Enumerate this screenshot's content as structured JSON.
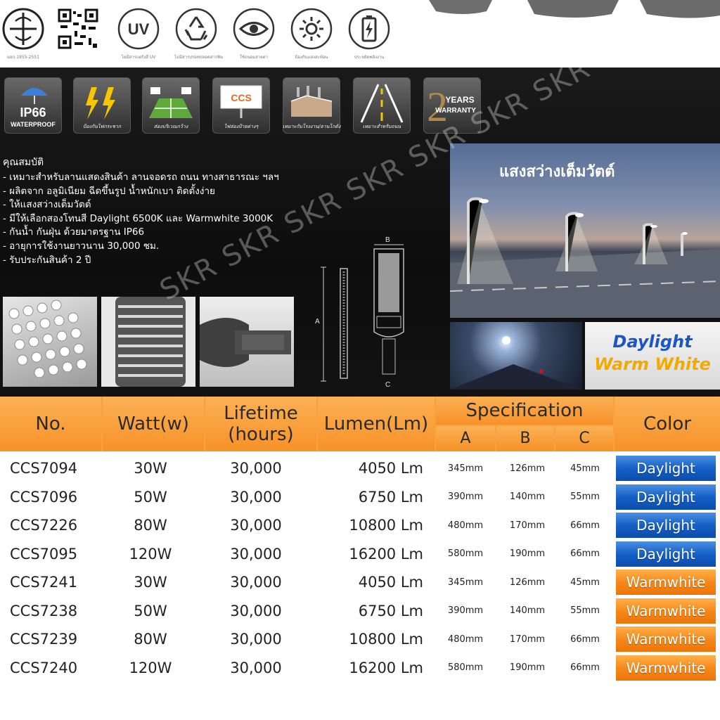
{
  "certifications": [
    {
      "icon": "tis-standard-icon",
      "caption": "มอก.1955-2551"
    },
    {
      "icon": "qr-code-icon",
      "caption": ""
    },
    {
      "icon": "uv-icon",
      "label": "UV",
      "caption": "ไม่มีสารแผ่รังสี UV"
    },
    {
      "icon": "recycle-icon",
      "caption": "ไม่มีสารปรอทปลอดสารพิษ"
    },
    {
      "icon": "eye-icon",
      "caption": "ใช้ถนอมสายตา"
    },
    {
      "icon": "sun-icon",
      "caption": "ป้องกันแสงสะท้อน"
    },
    {
      "icon": "battery-icon",
      "caption": "ประหยัดพลังงาน"
    }
  ],
  "features": [
    {
      "icon": "umbrella-icon",
      "title": "IP66",
      "label": "WATERPROOF"
    },
    {
      "icon": "lightning-icon",
      "label": "ป้องกันไฟกระชาก"
    },
    {
      "icon": "stadium-lights-icon",
      "label": "ส่องบริเวณกว้าง"
    },
    {
      "icon": "billboard-icon",
      "badge": "CCS",
      "label": "ไฟส่องป้ายต่างๆ"
    },
    {
      "icon": "building-icon",
      "label": "เหมาะกับโรงงาน/ลานโกดัง"
    },
    {
      "icon": "road-icon",
      "label": "เหมาะสำหรับถนน"
    },
    {
      "icon": "warranty-icon",
      "big": "2",
      "years": "YEARS",
      "warranty": "WARRANTY"
    }
  ],
  "properties": {
    "heading": "คุณสมบัติ",
    "items": [
      "- เหมาะสำหรับลานแสดงสินค้า ลานจอดรถ ถนน ทางสาธารณะ ฯลฯ",
      "- ผลิตจาก อลูมิเนียม ฉีดขึ้นรูป น้ำหนักเบา ติดตั้งง่าย",
      "- ให้แสงสว่างเต็มวัตต์",
      "- มีให้เลือกสองโทนสี Daylight 6500K และ Warmwhite 3000K",
      "- กันน้ำ กันฝุ่น ด้วยมาตรฐาน IP66",
      "- อายุการใช้งานยาวนาน 30,000 ชม.",
      "- รับประกันสินค้า 2 ปี"
    ]
  },
  "road_photo_title": "แสงสว่างเต็มวัตต์",
  "color_box": {
    "daylight": "Daylight",
    "warm": "Warm White"
  },
  "drawing_labels": {
    "a": "A",
    "b": "B",
    "c": "C"
  },
  "watermark": "SKR SKR SKR SKR SKR SKR SKR",
  "table": {
    "headers": {
      "no": "No.",
      "watt": "Watt(w)",
      "lifetime": "Lifetime\n(hours)",
      "lumen": "Lumen(Lm)",
      "spec": "Specification",
      "a": "A",
      "b": "B",
      "c": "C",
      "color": "Color"
    },
    "rows": [
      {
        "no": "CCS7094",
        "watt": "30W",
        "life": "30,000",
        "lumen": "4050 Lm",
        "a": "345mm",
        "b": "126mm",
        "c": "45mm",
        "color": "Daylight",
        "tone": "day"
      },
      {
        "no": "CCS7096",
        "watt": "50W",
        "life": "30,000",
        "lumen": "6750 Lm",
        "a": "390mm",
        "b": "140mm",
        "c": "55mm",
        "color": "Daylight",
        "tone": "day"
      },
      {
        "no": "CCS7226",
        "watt": "80W",
        "life": "30,000",
        "lumen": "10800 Lm",
        "a": "480mm",
        "b": "170mm",
        "c": "66mm",
        "color": "Daylight",
        "tone": "day"
      },
      {
        "no": "CCS7095",
        "watt": "120W",
        "life": "30,000",
        "lumen": "16200 Lm",
        "a": "580mm",
        "b": "190mm",
        "c": "66mm",
        "color": "Daylight",
        "tone": "day"
      },
      {
        "no": "CCS7241",
        "watt": "30W",
        "life": "30,000",
        "lumen": "4050 Lm",
        "a": "345mm",
        "b": "126mm",
        "c": "45mm",
        "color": "Warmwhite",
        "tone": "warm"
      },
      {
        "no": "CCS7238",
        "watt": "50W",
        "life": "30,000",
        "lumen": "6750 Lm",
        "a": "390mm",
        "b": "140mm",
        "c": "55mm",
        "color": "Warmwhite",
        "tone": "warm"
      },
      {
        "no": "CCS7239",
        "watt": "80W",
        "life": "30,000",
        "lumen": "10800 Lm",
        "a": "480mm",
        "b": "170mm",
        "c": "66mm",
        "color": "Warmwhite",
        "tone": "warm"
      },
      {
        "no": "CCS7240",
        "watt": "120W",
        "life": "30,000",
        "lumen": "16200 Lm",
        "a": "580mm",
        "b": "190mm",
        "c": "66mm",
        "color": "Warmwhite",
        "tone": "warm"
      }
    ]
  },
  "colors": {
    "header_orange": "#f9a13a",
    "daylight_blue": "#1560c8",
    "warm_orange": "#f5891b",
    "panel_dark": "#121212"
  }
}
